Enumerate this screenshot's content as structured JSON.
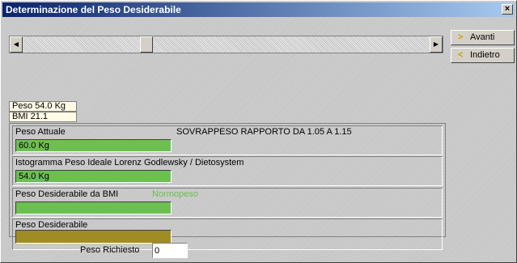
{
  "window": {
    "title": "Determinazione del Peso Desiderabile",
    "close_symbol": "×"
  },
  "scrollbar": {
    "left_arrow": "◀",
    "right_arrow": "▶",
    "left_arrow_icon": "left-arrow-icon",
    "right_arrow_icon": "right-arrow-icon"
  },
  "nav": {
    "forward_label": "Avanti",
    "back_label": "Indietro",
    "forward_icon_glyph": ">",
    "back_icon_glyph": "<",
    "forward_icon": "chevron-right-icon",
    "back_icon": "chevron-left-icon"
  },
  "info": {
    "weight": "Peso 54.0 Kg",
    "bmi": "BMI 21.1"
  },
  "rows": [
    {
      "label": "Peso Attuale",
      "note": "SOVRAPPESO RAPPORTO DA 1.05 A 1.15",
      "value": "60.0 Kg",
      "bar_color": "#6cc051"
    },
    {
      "label": "Istogramma Peso Ideale Lorenz Godlewsky / Dietosystem",
      "value": "54.0 Kg",
      "bar_color": "#6cc051"
    },
    {
      "label": "Peso Desiderabile da BMI",
      "note": "Normopeso",
      "note_color": "#6cc051",
      "value": "",
      "bar_color": "#6cc051"
    },
    {
      "label": "Peso Desiderabile",
      "value": "",
      "bar_color": "#a08c24"
    }
  ],
  "request": {
    "label": "Peso Richiesto",
    "value": "0"
  }
}
